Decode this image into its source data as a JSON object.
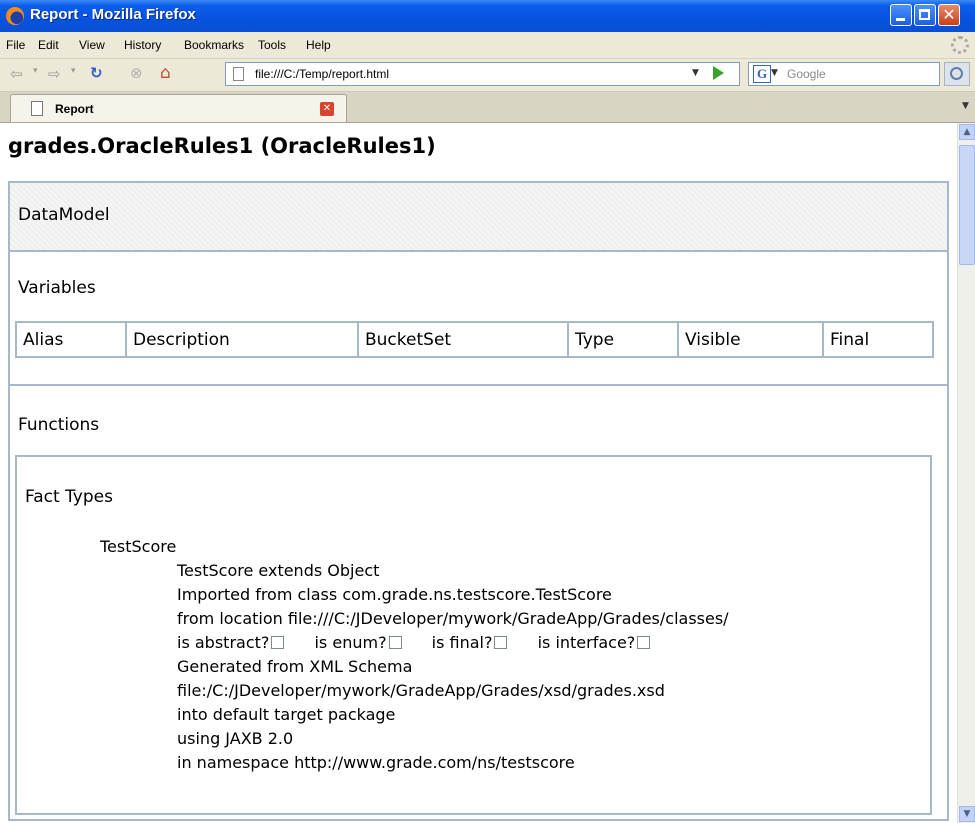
{
  "window": {
    "title": "Report - Mozilla Firefox"
  },
  "menu": [
    "File",
    "Edit",
    "View",
    "History",
    "Bookmarks",
    "Tools",
    "Help"
  ],
  "nav": {
    "url": "file:///C:/Temp/report.html",
    "search_placeholder": "Google"
  },
  "tab": {
    "label": "Report"
  },
  "page": {
    "title": "grades.OracleRules1 (OracleRules1)",
    "datamodel": "DataModel",
    "variables_title": "Variables",
    "columns": [
      "Alias",
      "Description",
      "BucketSet",
      "Type",
      "Visible",
      "Final"
    ],
    "functions_title": "Functions",
    "fact_types_title": "Fact Types",
    "fact": {
      "name": "TestScore",
      "extends": "TestScore extends Object",
      "imported": "Imported from class com.grade.ns.testscore.TestScore",
      "location": "from location file:///C:/JDeveloper/mywork/GradeApp/Grades/classes/",
      "flags": [
        "is abstract?",
        "is enum?",
        "is final?",
        "is interface?"
      ],
      "generated": "Generated from XML Schema",
      "xsd": "file:/C:/JDeveloper/mywork/GradeApp/Grades/xsd/grades.xsd",
      "package": "into default target package",
      "jaxb": "using JAXB 2.0",
      "namespace": "in namespace http://www.grade.com/ns/testscore"
    }
  }
}
